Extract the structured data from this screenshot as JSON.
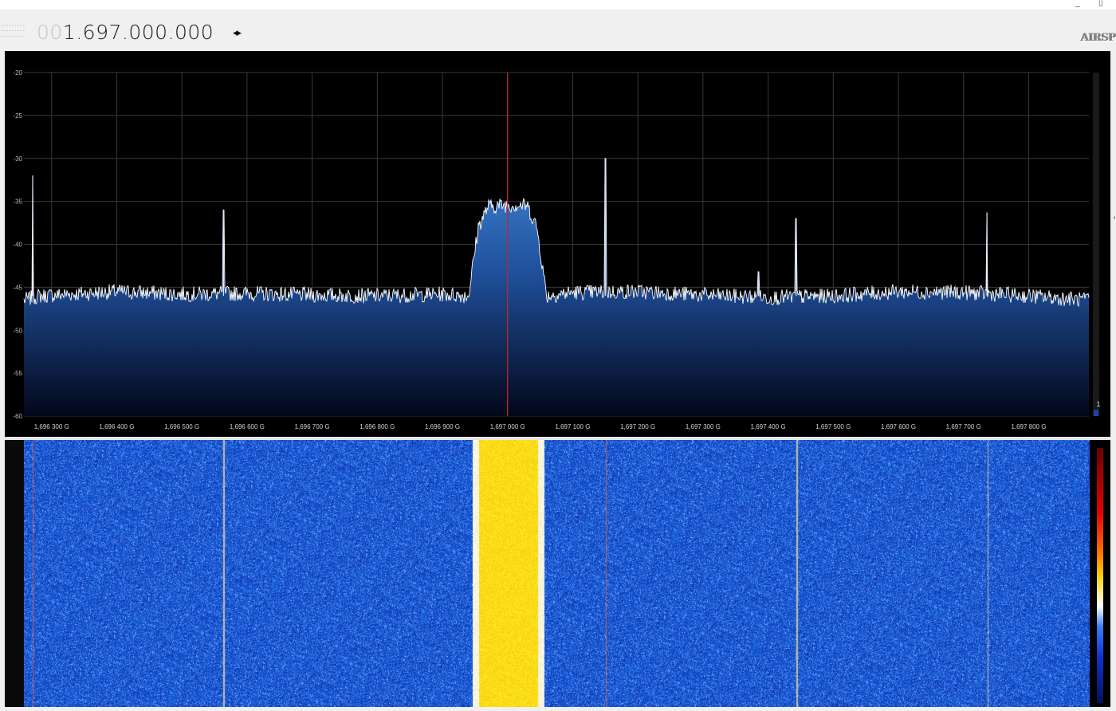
{
  "window": {
    "controls_label": "_ ▯"
  },
  "toolbar": {
    "frequency_leading_zeros": "00",
    "frequency_value": "1.697.000.000",
    "tune_arrows_icon": "◂▸",
    "logo_text": "AIRSP"
  },
  "spectrum": {
    "background_color": "#000000",
    "grid_color": "#3a3a3a",
    "center_marker_color": "#c0262a",
    "trace_color": "#ffffff",
    "fill_top_color": "#3f86d6",
    "fill_bottom_color": "#03071a",
    "level_marker_label": "1"
  },
  "chart_data": {
    "type": "area",
    "xlabel": "",
    "ylabel": "",
    "xlim": [
      1696.2575,
      1697.8925
    ],
    "ylim": [
      -60,
      -20
    ],
    "grid": true,
    "yticks": [
      -20,
      -25,
      -30,
      -35,
      -40,
      -45,
      -50,
      -55,
      -60
    ],
    "ytick_labels": [
      "-20",
      "-25",
      "-30",
      "-35",
      "-40",
      "-45",
      "-50",
      "-55",
      "-60"
    ],
    "xticks": [
      1696.3,
      1696.4,
      1696.5,
      1696.6,
      1696.7,
      1696.8,
      1696.9,
      1697.0,
      1697.1,
      1697.2,
      1697.3,
      1697.4,
      1697.5,
      1697.6,
      1697.7,
      1697.8
    ],
    "xtick_labels": [
      "1,696 300 G",
      "1,696 400 G",
      "1,696 500 G",
      "1,696 600 G",
      "1,696 700 G",
      "1,696 800 G",
      "1,696 900 G",
      "1,697 000 G",
      "1,697 100 G",
      "1,697 200 G",
      "1,697 300 G",
      "1,697 400 G",
      "1,697 500 G",
      "1,697 600 G",
      "1,697 700 G",
      "1,697 800 G"
    ],
    "center_frequency": 1697.0,
    "noise_floor_db": -46,
    "series": [
      {
        "values_x": [
          1696.2575,
          1696.28,
          1696.4,
          1696.5,
          1696.6,
          1696.7,
          1696.8,
          1696.9,
          1696.94,
          1696.955,
          1696.97,
          1697.0,
          1697.03,
          1697.045,
          1697.06,
          1697.1,
          1697.2,
          1697.3,
          1697.4,
          1697.5,
          1697.6,
          1697.7,
          1697.8,
          1697.8925
        ],
        "values_y": [
          -46.5,
          -46,
          -45.5,
          -45.8,
          -45.7,
          -45.9,
          -46,
          -45.8,
          -46,
          -38,
          -35.6,
          -35.4,
          -35.5,
          -38,
          -46,
          -45.6,
          -45.5,
          -45.9,
          -46.2,
          -46,
          -45.5,
          -45.6,
          -46,
          -46.5
        ]
      }
    ],
    "spurs": [
      {
        "x": 1696.271,
        "y": -32
      },
      {
        "x": 1696.564,
        "y": -36
      },
      {
        "x": 1697.15,
        "y": -30
      },
      {
        "x": 1697.443,
        "y": -37
      },
      {
        "x": 1697.736,
        "y": -36.3
      },
      {
        "x": 1697.385,
        "y": -43.2
      }
    ]
  },
  "waterfall": {
    "band_center": 1697.0,
    "band_width_mhz": 0.1,
    "band_color": "#ffd400",
    "noise_color": "#1d3fc0",
    "spur_lines": [
      1696.271,
      1696.564,
      1697.15,
      1697.443,
      1697.736
    ]
  }
}
